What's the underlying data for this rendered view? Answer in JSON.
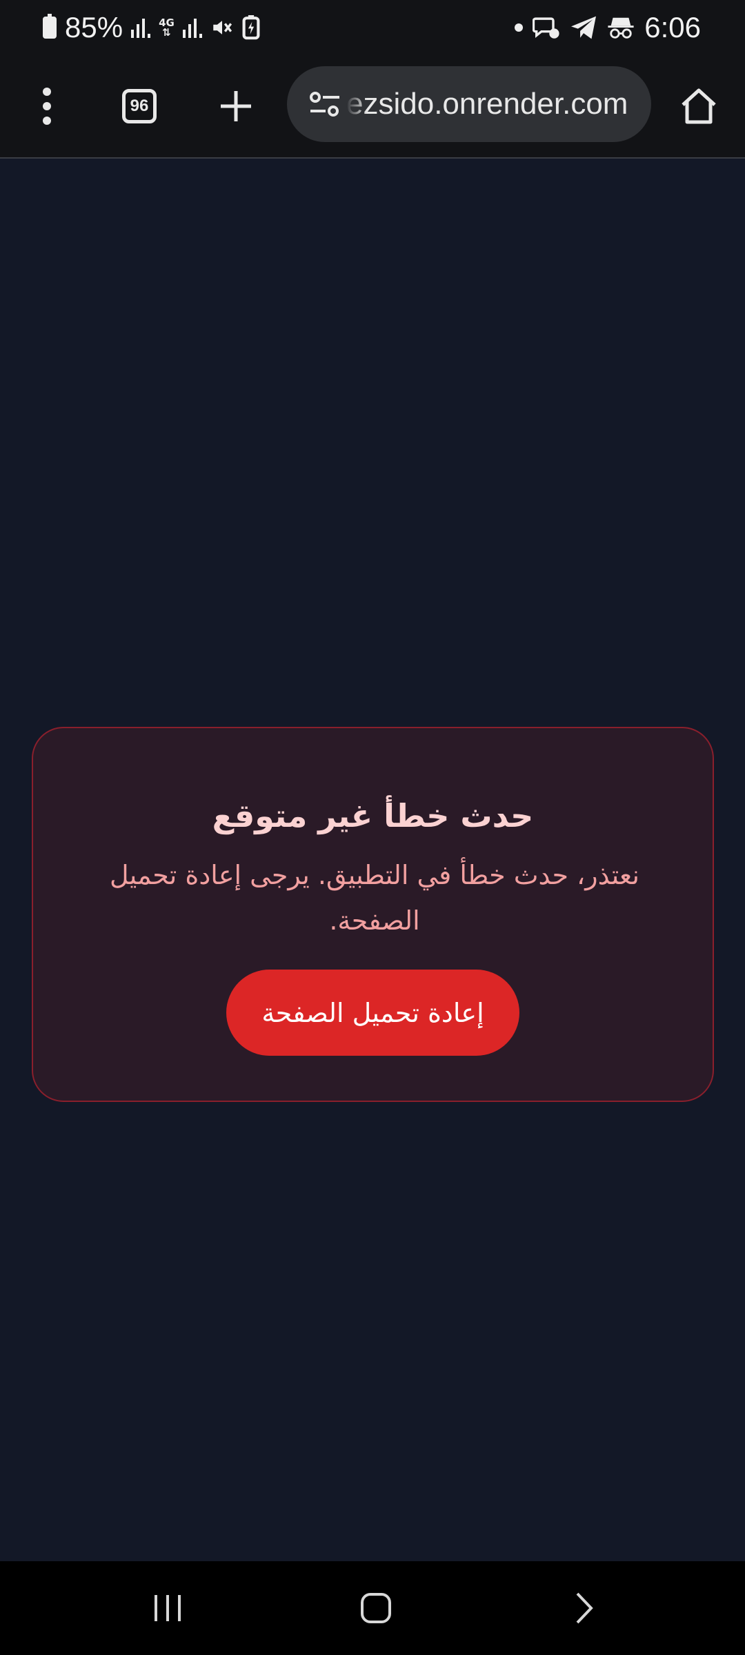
{
  "status_bar": {
    "battery_percent": "85%",
    "network_type": "4G",
    "time": "6:06",
    "icons": [
      "battery-icon",
      "signal-icon",
      "mobile-data-icon",
      "mute-icon",
      "battery-saver-icon",
      "notification-dot-icon",
      "chat-icon",
      "telegram-icon",
      "incognito-icon"
    ]
  },
  "toolbar": {
    "tab_count": "96",
    "url": "ezsido.onrender.com",
    "icons": [
      "more-menu-icon",
      "tab-switcher-icon",
      "new-tab-icon",
      "site-settings-icon",
      "home-icon"
    ]
  },
  "error": {
    "title": "حدث خطأ غير متوقع",
    "message": "نعتذر، حدث خطأ في التطبيق. يرجى إعادة تحميل الصفحة.",
    "reload_label": "إعادة تحميل الصفحة"
  },
  "colors": {
    "page_background": "#131827",
    "card_background": "#2a1a27",
    "card_border": "#8a1f2c",
    "button": "#dc2626",
    "title": "#fbd2d2",
    "message": "#f2a0a0"
  },
  "nav_bar": {
    "icons": [
      "recent-apps-icon",
      "home-nav-icon",
      "back-icon"
    ]
  }
}
